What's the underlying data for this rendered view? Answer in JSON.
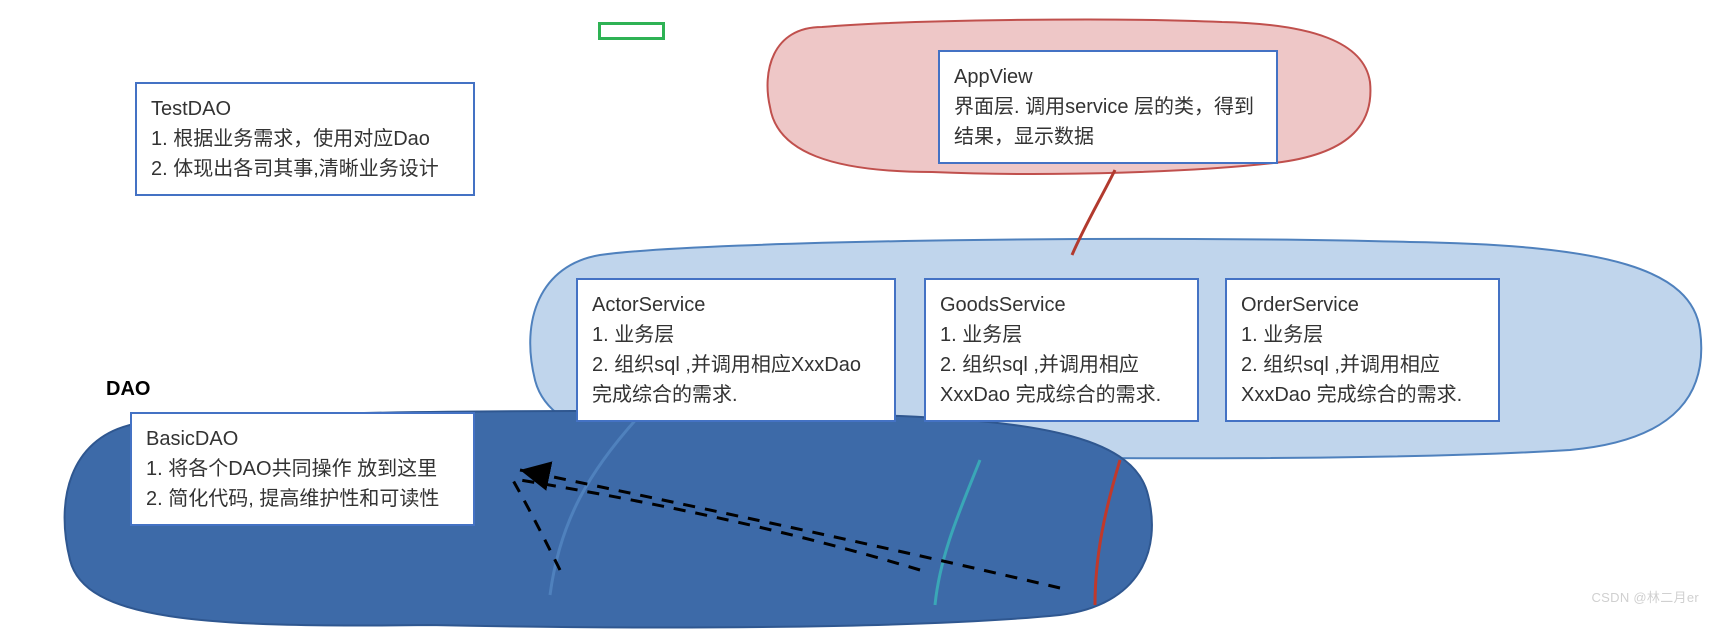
{
  "daoLabel": "DAO",
  "greenRect": {},
  "testDao": {
    "title": "TestDAO",
    "line1": "1. 根据业务需求，使用对应Dao",
    "line2": "2. 体现出各司其事,清晰业务设计"
  },
  "appView": {
    "title": "AppView",
    "line1": "界面层. 调用service 层的类，得到",
    "line2": "结果，显示数据"
  },
  "actorService": {
    "title": "ActorService",
    "line1": "1. 业务层",
    "line2": "2. 组织sql ,并调用相应XxxDao",
    "line3": "完成综合的需求."
  },
  "goodsService": {
    "title": "GoodsService",
    "line1": "1. 业务层",
    "line2": "2. 组织sql ,并调用相应",
    "line3": "XxxDao 完成综合的需求."
  },
  "orderService": {
    "title": "OrderService",
    "line1": "1. 业务层",
    "line2": "2. 组织sql ,并调用相应",
    "line3": "XxxDao 完成综合的需求."
  },
  "basicDao": {
    "title": "BasicDAO",
    "line1": "1. 将各个DAO共同操作 放到这里",
    "line2": "2. 简化代码, 提高维护性和可读性"
  },
  "watermark": "CSDN @林二月er"
}
